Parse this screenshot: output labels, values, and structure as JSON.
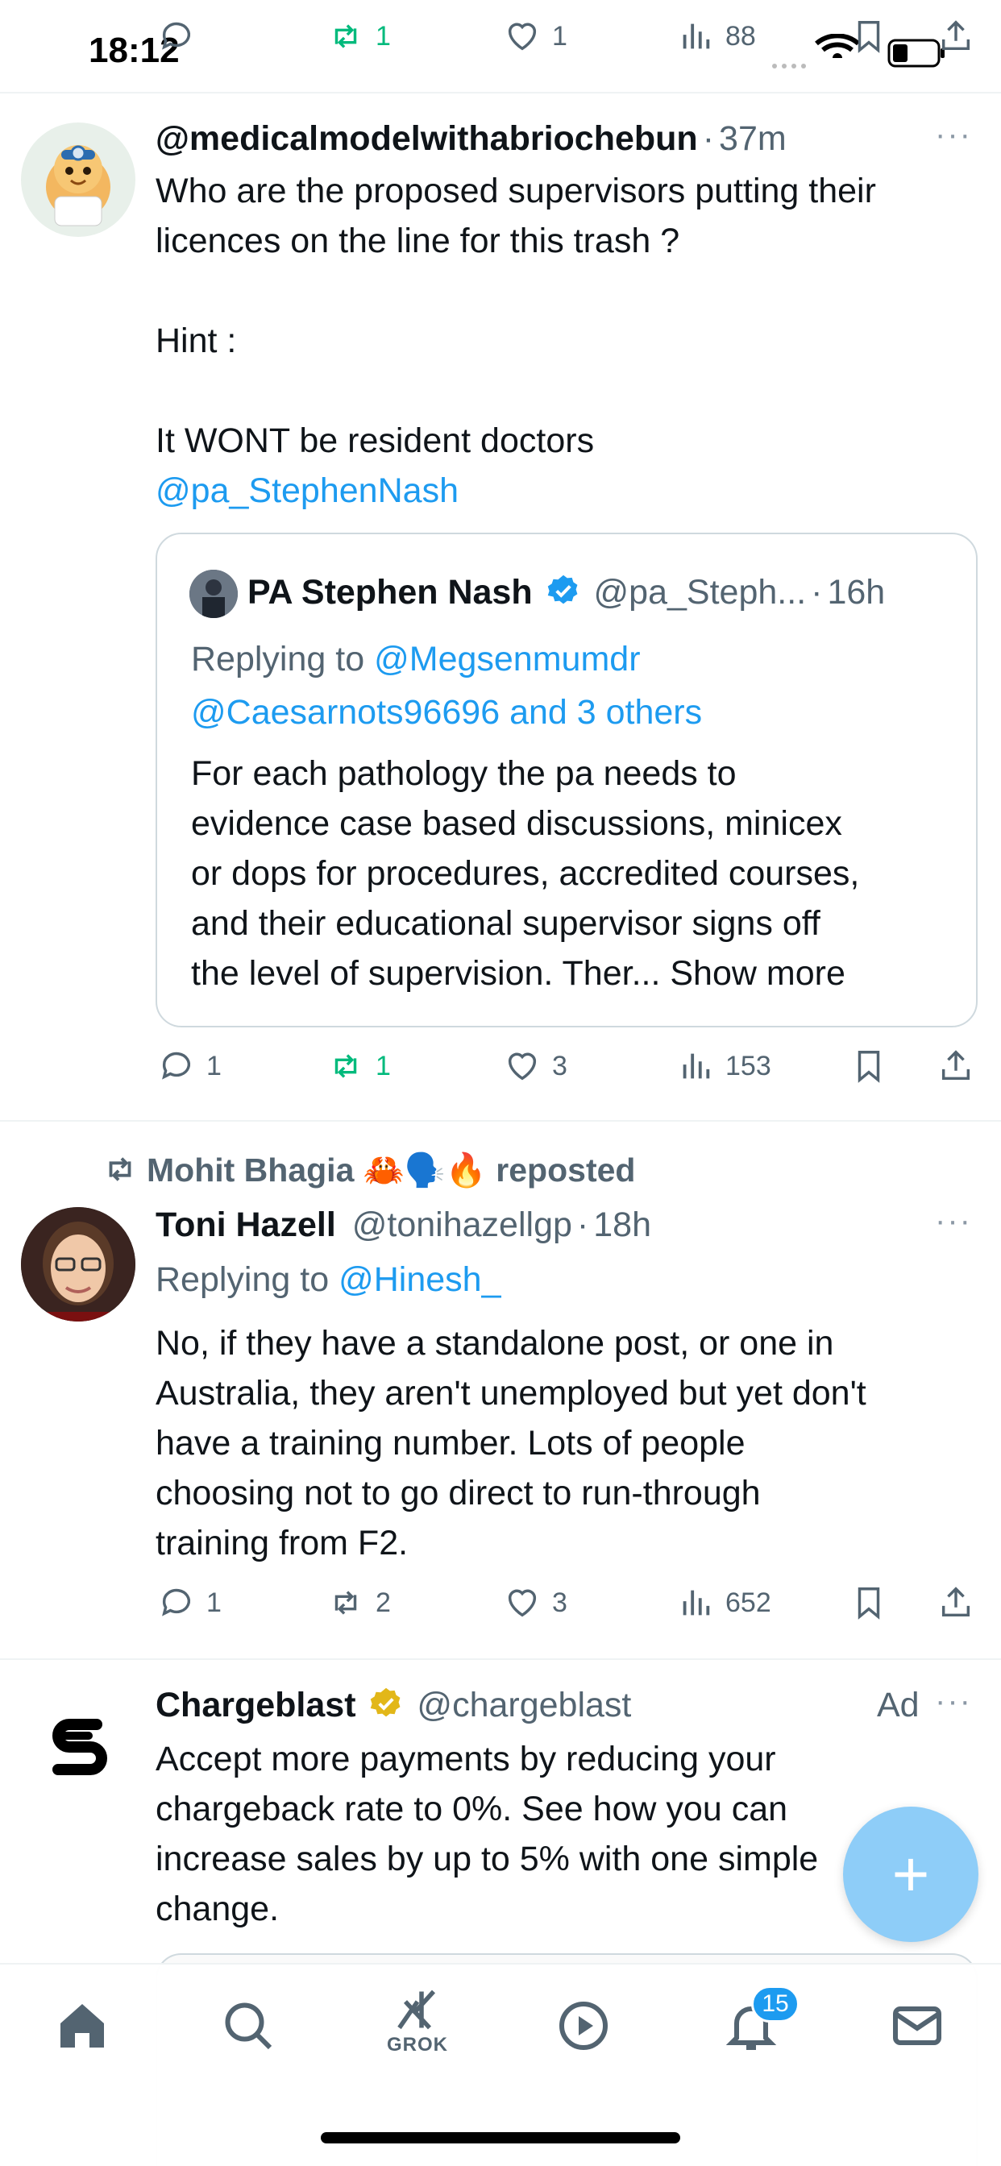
{
  "status_bar": {
    "time": "18:12"
  },
  "prev_actions": {
    "replies": "",
    "reposts": "1",
    "likes": "1",
    "views": "88"
  },
  "tweet1": {
    "handle": "@medicalmodelwithabriochebun",
    "dot": "·",
    "time": "37m",
    "more": "···",
    "lines": [
      "Who are the proposed supervisors putting their",
      "licences on the line for this trash ?",
      "",
      "Hint :",
      "",
      "It WONT be resident doctors"
    ],
    "mention": "@pa_StephenNash",
    "quote": {
      "name": "PA Stephen Nash",
      "handle": "@pa_Steph...",
      "dot": "·",
      "time": "16h",
      "replying_prefix": "Replying to",
      "replying_to_1": "@Megsenmumdr",
      "replying_to_2": "@Caesarnots96696 and 3 others",
      "lines": [
        "For each pathology the pa needs to",
        "evidence case based discussions, minicex",
        "or dops for procedures, accredited courses,",
        "and their educational supervisor signs off",
        "the level of supervision. Ther..."
      ],
      "show_more": "Show more"
    },
    "actions": {
      "replies": "1",
      "reposts": "1",
      "likes": "3",
      "views": "153"
    }
  },
  "tweet2": {
    "repost_by": "Mohit Bhagia 🦀🗣️🔥 reposted",
    "name": "Toni Hazell",
    "handle": "@tonihazellgp",
    "dot": "·",
    "time": "18h",
    "more": "···",
    "replying_prefix": "Replying to",
    "replying_to": "@Hinesh_",
    "lines": [
      "No, if they have a standalone post, or one in",
      "Australia, they aren't unemployed but yet don't",
      "have a training number. Lots of people",
      "choosing not to go direct to run-through",
      "training from F2."
    ],
    "actions": {
      "replies": "1",
      "reposts": "2",
      "likes": "3",
      "views": "652"
    }
  },
  "tweet3": {
    "name": "Chargeblast",
    "handle": "@chargeblast",
    "ad_label": "Ad",
    "more": "···",
    "lines": [
      "Accept more payments by reducing your",
      "chargeback rate to 0%. See how you can",
      "increase sales by up to 5% with one simple",
      "change."
    ]
  },
  "fab": {
    "label": "+"
  },
  "nav": {
    "grok_label": "GROK",
    "notifications_count": "15"
  },
  "colors": {
    "accent": "#1d9bf0",
    "repost_green": "#00ba7c",
    "muted": "#536471",
    "verified_gold": "#e2b719"
  }
}
